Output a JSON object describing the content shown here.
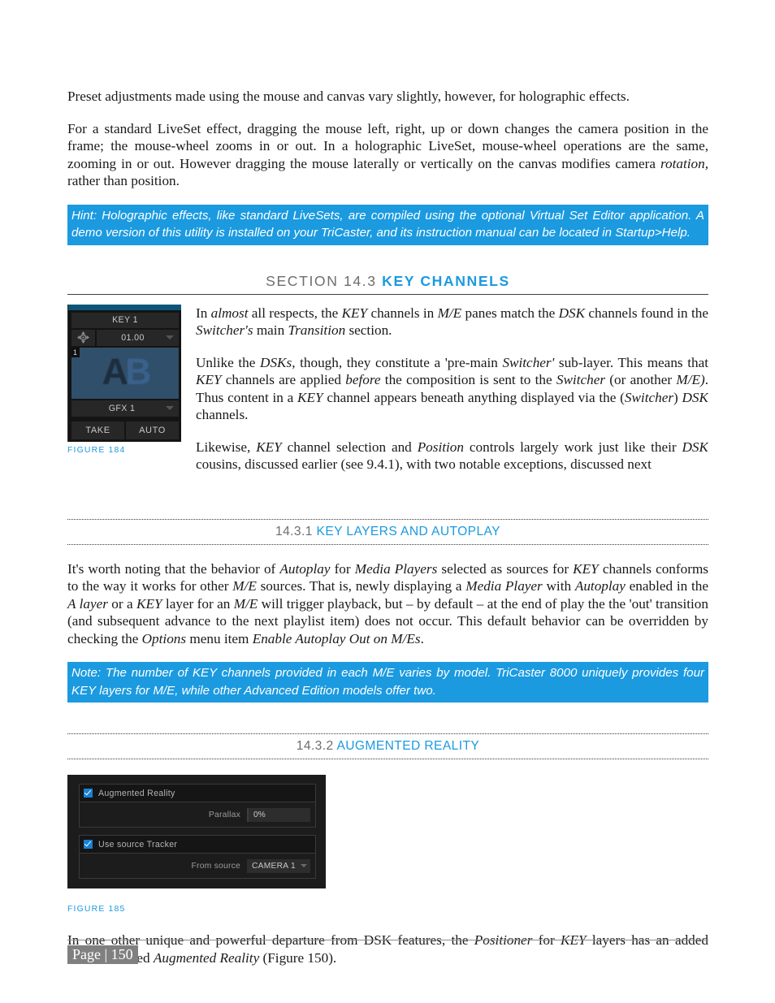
{
  "document": {
    "paragraph_1": "Preset adjustments made using the mouse and canvas vary slightly, however, for holographic effects.",
    "paragraph_2_parts": {
      "a": "For a standard LiveSet effect, dragging the mouse left, right, up or down changes the camera position in the frame; the mouse-wheel zooms in or out.  In a holographic LiveSet, mouse-wheel operations are the same, zooming in or out.  However dragging the mouse laterally or vertically on the canvas modifies camera ",
      "b": "rotation,",
      "c": " rather than position."
    },
    "hint_callout": "Hint:  Holographic effects, like standard LiveSets, are compiled using the optional Virtual Set Editor application.  A demo version of this utility is installed on your TriCaster, and its instruction manual can be located in Startup>Help.",
    "note_callout": "Note: The number of KEY channels provided in each M/E varies by model.  TriCaster 8000 uniquely provides four KEY layers for M/E, while other Advanced Edition models offer two.",
    "final_paragraph": {
      "a": "In one other unique and powerful departure from DSK features, the ",
      "b": "Positioner",
      "c": " for ",
      "d": "KEY",
      "e": " layers has an added feature labeled ",
      "f": "Augmented Reality",
      "g": " (Figure 150)."
    }
  },
  "section": {
    "number": "SECTION 14.3",
    "title": "KEY CHANNELS"
  },
  "subsections": [
    {
      "number": "14.3.1",
      "title": "KEY LAYERS AND AUTOPLAY"
    },
    {
      "number": "14.3.2",
      "title": "AUGMENTED REALITY"
    }
  ],
  "key_channels_text": {
    "p1": {
      "a": "In ",
      "b": "almost",
      "c": " all respects, the ",
      "d": "KEY",
      "e": " channels in ",
      "f": "M/E",
      "g": " panes match the ",
      "h": "DSK",
      "i": " channels found in the ",
      "j": "Switcher's",
      "k": " main ",
      "l": "Transition",
      "m": " section."
    },
    "p2": {
      "a": "Unlike the ",
      "b": "DSKs",
      "c": ", though, they constitute a 'pre-main ",
      "d": "Switcher'",
      "e": " sub-layer. This means that ",
      "f": "KEY",
      "g": " channels are applied ",
      "h": "before",
      "i": " the composition is sent to the ",
      "j": "Switcher",
      "k": " (or another ",
      "l": "M/E)",
      "m": ".  Thus content in a ",
      "n": "KEY",
      "o": " channel appears beneath anything displayed via the (",
      "p": "Switcher",
      "q": ") ",
      "r": "DSK",
      "s": " channels."
    },
    "p3": {
      "a": "Likewise, ",
      "b": "KEY",
      "c": " channel selection and ",
      "d": "Position",
      "e": " controls largely work just like their ",
      "f": "DSK",
      "g": " cousins, discussed earlier (see 9.4.1), with two notable exceptions, discussed next"
    }
  },
  "autoplay_text": {
    "a": "It's worth noting that the behavior of ",
    "b": "Autoplay",
    "c": " for ",
    "d": "Media Players",
    "e": " selected as sources for ",
    "f": "KEY",
    "g": " channels conforms to the way it works for other ",
    "h": "M/E",
    "i": " sources.  That is, newly displaying a ",
    "j": "Media Player",
    "k": " with ",
    "l": "Autoplay",
    "m": " enabled in the ",
    "n": "A layer",
    "o": " or a ",
    "p": "KEY",
    "q": " layer for an ",
    "r": "M/E",
    "s": " will trigger playback, but – by default – at the end of play the the 'out' transition (and subsequent advance to the next playlist item) does not occur.  This default behavior can be overridden by checking the ",
    "t": "Options",
    "u": " menu item ",
    "v": "Enable Autoplay Out on M/Es",
    "w": "."
  },
  "figure_184": {
    "caption": "FIGURE 184",
    "title": "KEY 1",
    "duration": "01.00",
    "positioner_icon": "positioner-compass-icon",
    "preview_index": "1",
    "preview_text_a": "A",
    "preview_text_b": "B",
    "source": "GFX 1",
    "take_label": "TAKE",
    "auto_label": "AUTO"
  },
  "figure_185": {
    "caption": "FIGURE 185",
    "augmented_reality_label": "Augmented Reality",
    "augmented_reality_checked": true,
    "parallax_label": "Parallax",
    "parallax_value": "0%",
    "use_source_tracker_label": "Use source Tracker",
    "use_source_tracker_checked": true,
    "from_source_label": "From source",
    "from_source_value": "CAMERA 1"
  },
  "footer": {
    "page_label": "Page | 150"
  },
  "colors": {
    "accent_blue": "#1b9ae0",
    "heading_gray": "#6e6e6e",
    "callout_bg": "#1b9ae0",
    "panel_bg": "#1c1c1c",
    "checkbox_blue": "#1b7fd4",
    "footer_highlight": "#808080"
  }
}
